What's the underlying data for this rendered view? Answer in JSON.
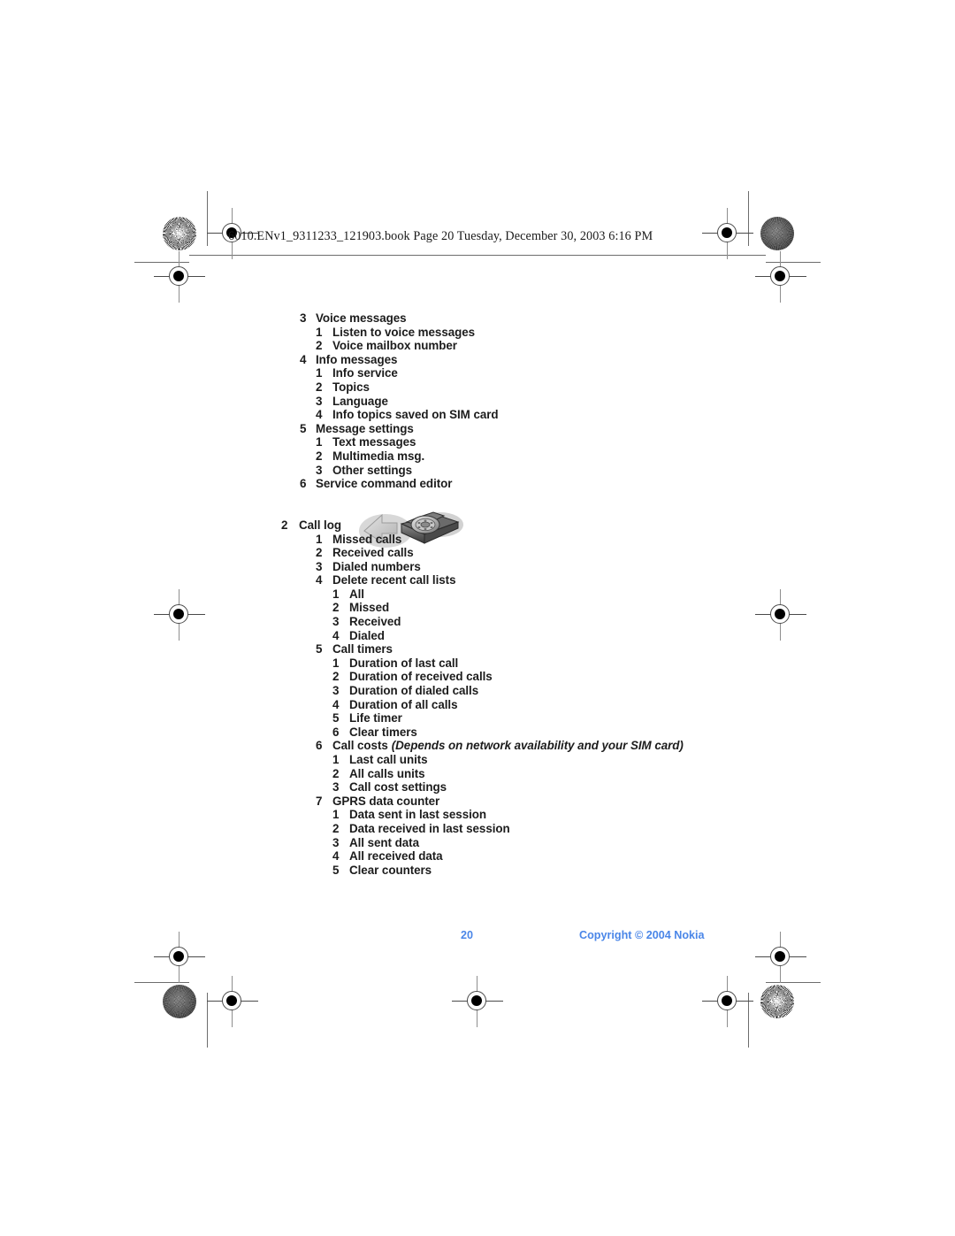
{
  "header": {
    "source_line": "6010.ENv1_9311233_121903.book  Page 20  Tuesday, December 30, 2003  6:16 PM"
  },
  "footer": {
    "page_number": "20",
    "copyright": "Copyright © 2004 Nokia",
    "color": "#4a86e8"
  },
  "icons": {
    "rotary_phone": "rotary-phone-icon"
  },
  "outline": [
    {
      "level": 1,
      "num": "3",
      "label": "Voice messages"
    },
    {
      "level": 2,
      "num": "1",
      "label": "Listen to voice messages"
    },
    {
      "level": 2,
      "num": "2",
      "label": "Voice mailbox number"
    },
    {
      "level": 1,
      "num": "4",
      "label": "Info messages"
    },
    {
      "level": 2,
      "num": "1",
      "label": "Info service"
    },
    {
      "level": 2,
      "num": "2",
      "label": "Topics"
    },
    {
      "level": 2,
      "num": "3",
      "label": "Language"
    },
    {
      "level": 2,
      "num": "4",
      "label": "Info topics saved on SIM card"
    },
    {
      "level": 1,
      "num": "5",
      "label": "Message settings"
    },
    {
      "level": 2,
      "num": "1",
      "label": "Text messages"
    },
    {
      "level": 2,
      "num": "2",
      "label": "Multimedia msg."
    },
    {
      "level": 2,
      "num": "3",
      "label": "Other settings"
    },
    {
      "level": 1,
      "num": "6",
      "label": "Service command editor"
    },
    {
      "level": -1,
      "num": "",
      "label": ""
    },
    {
      "level": -1,
      "num": "",
      "label": ""
    },
    {
      "level": 0,
      "num": "2",
      "label": "Call log"
    },
    {
      "level": 2,
      "num": "1",
      "label": "Missed calls"
    },
    {
      "level": 2,
      "num": "2",
      "label": "Received calls"
    },
    {
      "level": 2,
      "num": "3",
      "label": "Dialed numbers"
    },
    {
      "level": 2,
      "num": "4",
      "label": "Delete recent call lists"
    },
    {
      "level": 3,
      "num": "1",
      "label": "All"
    },
    {
      "level": 3,
      "num": "2",
      "label": "Missed"
    },
    {
      "level": 3,
      "num": "3",
      "label": "Received"
    },
    {
      "level": 3,
      "num": "4",
      "label": "Dialed"
    },
    {
      "level": 2,
      "num": "5",
      "label": "Call timers"
    },
    {
      "level": 3,
      "num": "1",
      "label": "Duration of last call"
    },
    {
      "level": 3,
      "num": "2",
      "label": "Duration of received calls"
    },
    {
      "level": 3,
      "num": "3",
      "label": "Duration of dialed calls"
    },
    {
      "level": 3,
      "num": "4",
      "label": "Duration of all calls"
    },
    {
      "level": 3,
      "num": "5",
      "label": "Life timer"
    },
    {
      "level": 3,
      "num": "6",
      "label": "Clear timers"
    },
    {
      "level": 2,
      "num": "6",
      "label": "Call costs",
      "note": "(Depends on network availability and your SIM card)"
    },
    {
      "level": 3,
      "num": "1",
      "label": "Last call units"
    },
    {
      "level": 3,
      "num": "2",
      "label": "All calls units"
    },
    {
      "level": 3,
      "num": "3",
      "label": "Call cost settings"
    },
    {
      "level": 2,
      "num": "7",
      "label": "GPRS data counter"
    },
    {
      "level": 3,
      "num": "1",
      "label": "Data sent in last session"
    },
    {
      "level": 3,
      "num": "2",
      "label": "Data received in last session"
    },
    {
      "level": 3,
      "num": "3",
      "label": "All sent data"
    },
    {
      "level": 3,
      "num": "4",
      "label": "All received data"
    },
    {
      "level": 3,
      "num": "5",
      "label": "Clear counters"
    }
  ]
}
